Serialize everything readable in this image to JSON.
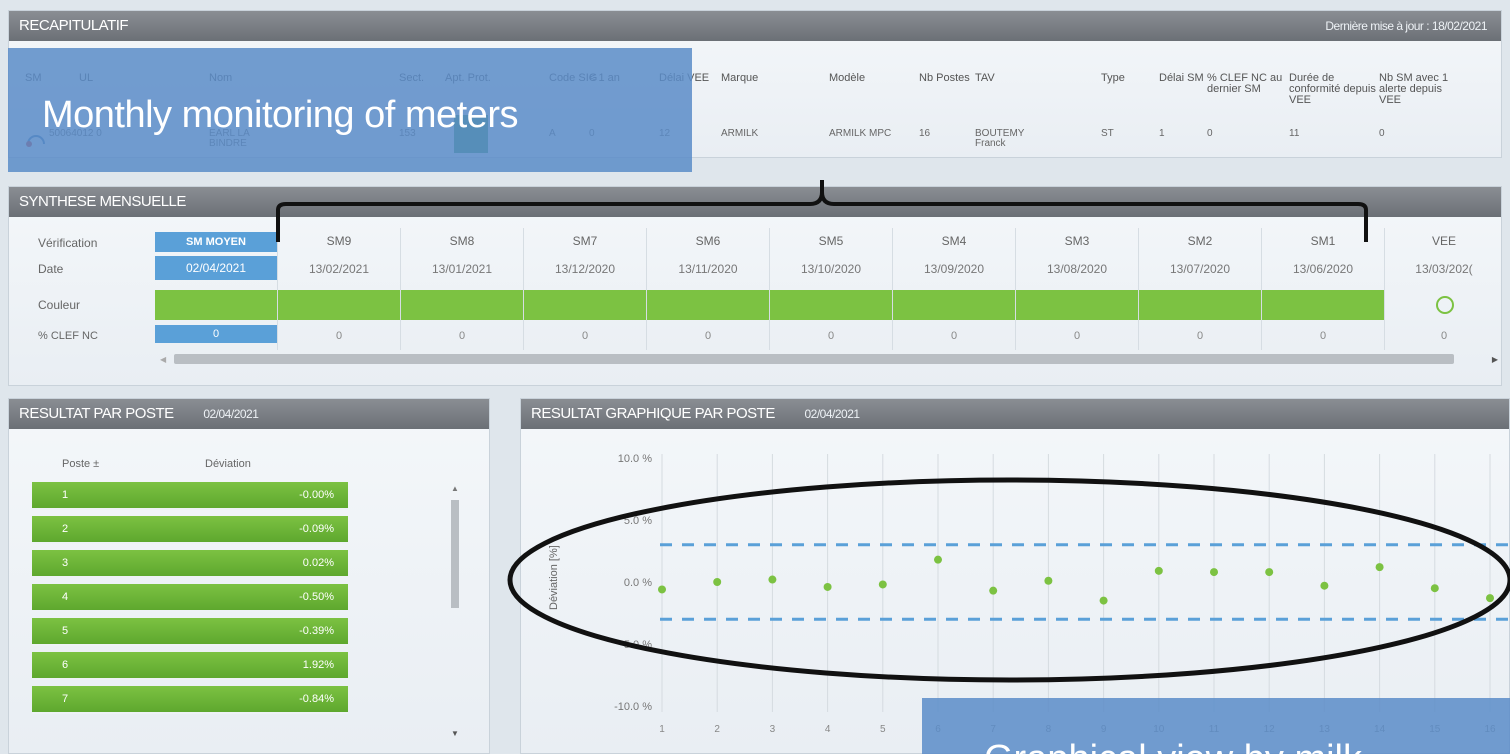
{
  "recap": {
    "title": "RECAPITULATIF",
    "update": "Dernière mise à jour : 18/02/2021",
    "headers": [
      "SM",
      "UL",
      "Nom",
      "Sect.",
      "Apt. Prot.",
      "Code SIG",
      "< 1 an",
      "Délai VEE",
      "Marque",
      "Modèle",
      "Nb Postes",
      "TAV",
      "Type",
      "Délai SM",
      "% CLEF NC au dernier SM",
      "Durée de conformité depuis VEE",
      "Nb SM avec 1 alerte depuis VEE"
    ],
    "values": [
      "",
      "50064012 0",
      "EARL LA BINDRE",
      "153",
      "",
      "A",
      "0",
      "12",
      "ARMILK",
      "ARMILK MPC",
      "16",
      "BOUTEMY Franck",
      "ST",
      "1",
      "0",
      "11",
      "0"
    ]
  },
  "overlay_top": "Monthly monitoring of meters",
  "synthese": {
    "title": "SYNTHESE MENSUELLE",
    "row_labels": [
      "Vérification",
      "Date",
      "Couleur",
      "% CLEF NC"
    ],
    "columns": [
      {
        "label": "SM MOYEN",
        "date": "02/04/2021",
        "pct": "0"
      },
      {
        "label": "SM9",
        "date": "13/02/2021",
        "pct": "0"
      },
      {
        "label": "SM8",
        "date": "13/01/2021",
        "pct": "0"
      },
      {
        "label": "SM7",
        "date": "13/12/2020",
        "pct": "0"
      },
      {
        "label": "SM6",
        "date": "13/11/2020",
        "pct": "0"
      },
      {
        "label": "SM5",
        "date": "13/10/2020",
        "pct": "0"
      },
      {
        "label": "SM4",
        "date": "13/09/2020",
        "pct": "0"
      },
      {
        "label": "SM3",
        "date": "13/08/2020",
        "pct": "0"
      },
      {
        "label": "SM2",
        "date": "13/07/2020",
        "pct": "0"
      },
      {
        "label": "SM1",
        "date": "13/06/2020",
        "pct": "0"
      }
    ],
    "vee": {
      "label": "VEE",
      "date": "13/03/202(",
      "pct": "0"
    },
    "color_green": "#7cc242",
    "selected_color": "#5aa0d8"
  },
  "resultat_poste": {
    "title": "RESULTAT PAR POSTE",
    "date": "02/04/2021",
    "col_poste": "Poste ±",
    "col_deviation": "Déviation",
    "rows": [
      {
        "poste": "1",
        "dev": "-0.00%"
      },
      {
        "poste": "2",
        "dev": "-0.09%"
      },
      {
        "poste": "3",
        "dev": "0.02%"
      },
      {
        "poste": "4",
        "dev": "-0.50%"
      },
      {
        "poste": "5",
        "dev": "-0.39%"
      },
      {
        "poste": "6",
        "dev": "1.92%"
      },
      {
        "poste": "7",
        "dev": "-0.84%"
      }
    ]
  },
  "graph": {
    "title": "RESULTAT GRAPHIQUE PAR POSTE",
    "date": "02/04/2021",
    "ylabel": "Déviation [%]",
    "overlay_bottom": "Graphical view by milk"
  },
  "chart_data": {
    "type": "scatter",
    "x": [
      1,
      2,
      3,
      4,
      5,
      6,
      7,
      8,
      9,
      10,
      11,
      12,
      13,
      14,
      15,
      16
    ],
    "values": [
      -0.6,
      0,
      0.2,
      -0.4,
      -0.2,
      1.8,
      -0.7,
      0.1,
      -1.5,
      0.9,
      0.8,
      0.8,
      -0.3,
      1.2,
      -0.5,
      -1.3
    ],
    "ylim": [
      -10,
      10
    ],
    "yticks": [
      "10.0 %",
      "5.0 %",
      "0.0 %",
      "-5.0 %",
      "-10.0 %"
    ],
    "thresholds": [
      3,
      -3
    ],
    "point_color": "#7cc242",
    "threshold_color": "#5aa0d8"
  }
}
